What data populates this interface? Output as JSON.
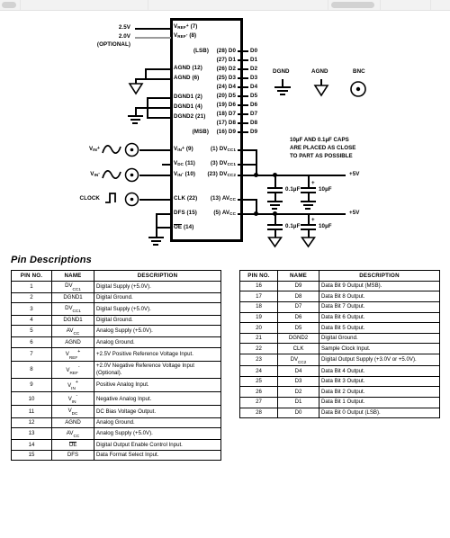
{
  "schematic": {
    "supply_labels": [
      {
        "text": "2.5V"
      },
      {
        "text": "2.0V"
      },
      {
        "text": "(OPTIONAL)"
      }
    ],
    "left_pins": [
      {
        "name": "VREF+",
        "pin": "(7)"
      },
      {
        "name": "VREF-",
        "pin": "(8)"
      },
      {
        "name": "AGND",
        "pin": "(12)"
      },
      {
        "name": "AGND",
        "pin": "(6)"
      },
      {
        "name": "DGND1",
        "pin": "(2)"
      },
      {
        "name": "DGND1",
        "pin": "(4)"
      },
      {
        "name": "DGND2",
        "pin": "(21)"
      },
      {
        "name": "VIN+",
        "pin": "(9)"
      },
      {
        "name": "VDC",
        "pin": "(11)"
      },
      {
        "name": "VIN-",
        "pin": "(10)"
      },
      {
        "name": "CLK",
        "pin": "(22)"
      },
      {
        "name": "DFS",
        "pin": "(15)"
      },
      {
        "name": "OE",
        "pin": "(14)"
      }
    ],
    "data_pins": [
      {
        "tag": "(LSB)",
        "pin": "(28)",
        "name": "D0",
        "net": "D0"
      },
      {
        "tag": "",
        "pin": "(27)",
        "name": "D1",
        "net": "D1"
      },
      {
        "tag": "",
        "pin": "(26)",
        "name": "D2",
        "net": "D2"
      },
      {
        "tag": "",
        "pin": "(25)",
        "name": "D3",
        "net": "D3"
      },
      {
        "tag": "",
        "pin": "(24)",
        "name": "D4",
        "net": "D4"
      },
      {
        "tag": "",
        "pin": "(20)",
        "name": "D5",
        "net": "D5"
      },
      {
        "tag": "",
        "pin": "(19)",
        "name": "D6",
        "net": "D6"
      },
      {
        "tag": "",
        "pin": "(18)",
        "name": "D7",
        "net": "D7"
      },
      {
        "tag": "",
        "pin": "(17)",
        "name": "D8",
        "net": "D8"
      },
      {
        "tag": "(MSB)",
        "pin": "(16)",
        "name": "D9",
        "net": "D9"
      }
    ],
    "right_supply_pins": [
      {
        "pin": "(1)",
        "name": "DVCC1"
      },
      {
        "pin": "(3)",
        "name": "DVCC1"
      },
      {
        "pin": "(23)",
        "name": "DVCC2"
      },
      {
        "pin": "(13)",
        "name": "AVCC"
      },
      {
        "pin": "(5)",
        "name": "AVCC"
      }
    ],
    "input_sources": [
      {
        "label": "VIN+"
      },
      {
        "label": "VIN-"
      },
      {
        "label": "CLOCK"
      }
    ],
    "ground_symbols": [
      {
        "label": "DGND"
      },
      {
        "label": "AGND"
      },
      {
        "label": "BNC"
      }
    ],
    "caps_note": [
      "10µF AND 0.1µF CAPS",
      "ARE PLACED AS CLOSE",
      "TO PART AS POSSIBLE"
    ],
    "capacitors": [
      {
        "value": "0.1µF"
      },
      {
        "value": "10µF"
      },
      {
        "value": "0.1µF"
      },
      {
        "value": "10µF"
      }
    ],
    "rails": [
      {
        "label": "+5V"
      },
      {
        "label": "+5V"
      }
    ]
  },
  "pin_descriptions": {
    "heading": "Pin Descriptions",
    "columns": [
      "PIN NO.",
      "NAME",
      "DESCRIPTION"
    ],
    "left_rows": [
      {
        "no": "1",
        "name": "DV",
        "sub": "CC1",
        "sup": "",
        "desc": "Digital Supply (+5.0V)."
      },
      {
        "no": "2",
        "name": "DGND1",
        "sub": "",
        "sup": "",
        "desc": "Digital Ground."
      },
      {
        "no": "3",
        "name": "DV",
        "sub": "CC1",
        "sup": "",
        "desc": "Digital Supply (+5.0V)."
      },
      {
        "no": "4",
        "name": "DGND1",
        "sub": "",
        "sup": "",
        "desc": "Digital Ground."
      },
      {
        "no": "5",
        "name": "AV",
        "sub": "CC",
        "sup": "",
        "desc": "Analog Supply (+5.0V)."
      },
      {
        "no": "6",
        "name": "AGND",
        "sub": "",
        "sup": "",
        "desc": "Analog Ground."
      },
      {
        "no": "7",
        "name": "V",
        "sub": "REF",
        "sup": "+",
        "desc": "+2.5V Positive Reference Voltage Input."
      },
      {
        "no": "8",
        "name": "V",
        "sub": "REF",
        "sup": "-",
        "desc": "+2.0V Negative Reference Voltage Input (Optional)."
      },
      {
        "no": "9",
        "name": "V",
        "sub": "IN",
        "sup": "+",
        "desc": "Positive Analog Input."
      },
      {
        "no": "10",
        "name": "V",
        "sub": "IN",
        "sup": "-",
        "desc": "Negative Analog Input."
      },
      {
        "no": "11",
        "name": "V",
        "sub": "DC",
        "sup": "",
        "desc": "DC Bias Voltage Output."
      },
      {
        "no": "12",
        "name": "AGND",
        "sub": "",
        "sup": "",
        "desc": "Analog Ground."
      },
      {
        "no": "13",
        "name": "AV",
        "sub": "CC",
        "sup": "",
        "desc": "Analog Supply (+5.0V)."
      },
      {
        "no": "14",
        "name": "OE",
        "sub": "",
        "sup": "",
        "overline": true,
        "desc": "Digital Output Enable Control Input."
      },
      {
        "no": "15",
        "name": "DFS",
        "sub": "",
        "sup": "",
        "desc": "Data Format Select Input."
      }
    ],
    "right_rows": [
      {
        "no": "16",
        "name": "D9",
        "sub": "",
        "sup": "",
        "desc": "Data Bit 9 Output (MSB)."
      },
      {
        "no": "17",
        "name": "D8",
        "sub": "",
        "sup": "",
        "desc": "Data Bit 8 Output."
      },
      {
        "no": "18",
        "name": "D7",
        "sub": "",
        "sup": "",
        "desc": "Data Bit 7 Output."
      },
      {
        "no": "19",
        "name": "D6",
        "sub": "",
        "sup": "",
        "desc": "Data Bit 6 Output."
      },
      {
        "no": "20",
        "name": "D5",
        "sub": "",
        "sup": "",
        "desc": "Data Bit 5 Output."
      },
      {
        "no": "21",
        "name": "DGND2",
        "sub": "",
        "sup": "",
        "desc": "Digital Ground."
      },
      {
        "no": "22",
        "name": "CLK",
        "sub": "",
        "sup": "",
        "desc": "Sample Clock Input."
      },
      {
        "no": "23",
        "name": "DV",
        "sub": "CC2",
        "sup": "",
        "desc": "Digital Output Supply (+3.0V or +5.0V)."
      },
      {
        "no": "24",
        "name": "D4",
        "sub": "",
        "sup": "",
        "desc": "Data Bit 4 Output."
      },
      {
        "no": "25",
        "name": "D3",
        "sub": "",
        "sup": "",
        "desc": "Data Bit 3 Output."
      },
      {
        "no": "26",
        "name": "D2",
        "sub": "",
        "sup": "",
        "desc": "Data Bit 2 Output."
      },
      {
        "no": "27",
        "name": "D1",
        "sub": "",
        "sup": "",
        "desc": "Data Bit 1 Output."
      },
      {
        "no": "28",
        "name": "D0",
        "sub": "",
        "sup": "",
        "desc": "Data Bit 0 Output (LSB)."
      }
    ]
  }
}
